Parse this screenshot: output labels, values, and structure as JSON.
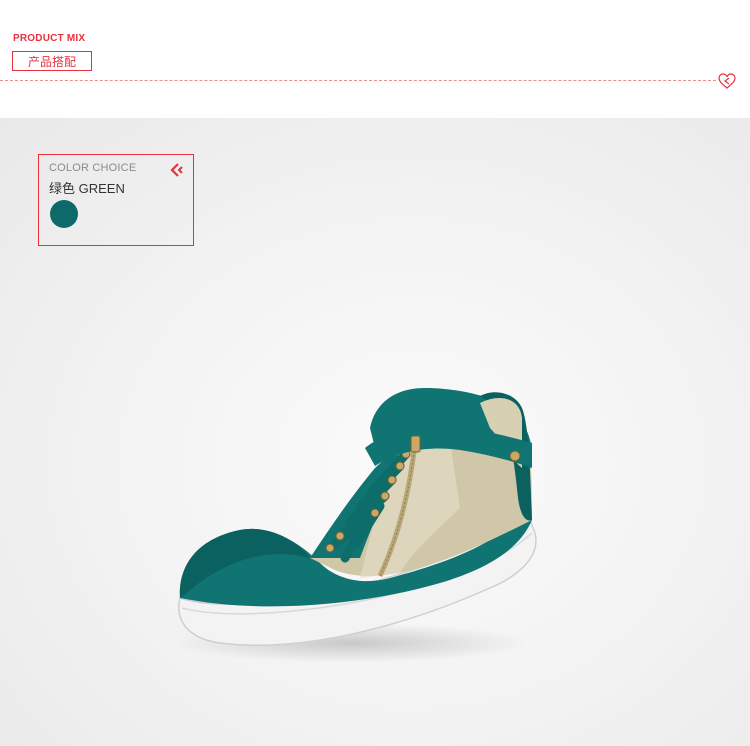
{
  "header": {
    "title": "PRODUCT MIX",
    "subtitle": "产品搭配"
  },
  "color_choice": {
    "label": "COLOR CHOICE",
    "name": "绿色 GREEN",
    "swatch_color": "#0e6a6a",
    "icon": "chevron-left-icon"
  },
  "product": {
    "image": "teal-high-top-sneaker",
    "colors": {
      "suede": "#0f7472",
      "metallic": "#cfc7a8",
      "sole": "#f4f4f4",
      "accent": "#e8313f"
    }
  }
}
